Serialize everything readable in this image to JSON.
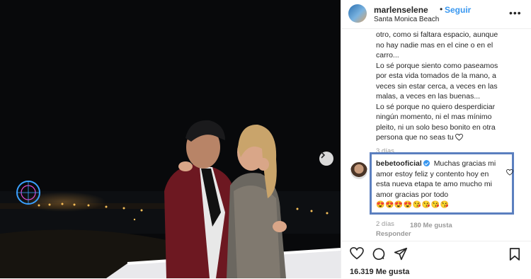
{
  "post": {
    "username": "marlenselene",
    "separator": "•",
    "follow_label": "Seguir",
    "location": "Santa Monica Beach",
    "more_label": "•••",
    "caption_lines": [
      "otro, como si faltara espacio, aunque no hay nadie mas en el cine o en el carro...",
      "Lo sé porque siento como paseamos por esta vida tomados de la mano, a veces sin estar cerca, a veces en las malas, a veces en las buenas...",
      "Lo sé porque no quiero desperdiciar ningún momento, ni el mas mínimo pleito, ni un solo beso bonito en otra persona que no seas tu"
    ],
    "time_ago": "3 días",
    "likes": "16.319 Me gusta"
  },
  "comment": {
    "username": "bebetooficial",
    "text": "Muchas gracias mi amor estoy feliz y contento hoy en esta nueva etapa te amo mucho mi amor gracias por todo",
    "emojis": "😍😍😍😍😘😘😘😘",
    "time_ago": "2 días",
    "likes": "180 Me gusta",
    "reply_label": "Responder"
  },
  "colors": {
    "accent": "#3897f0",
    "highlight_border": "#5b7fbf",
    "muted": "#999999"
  }
}
